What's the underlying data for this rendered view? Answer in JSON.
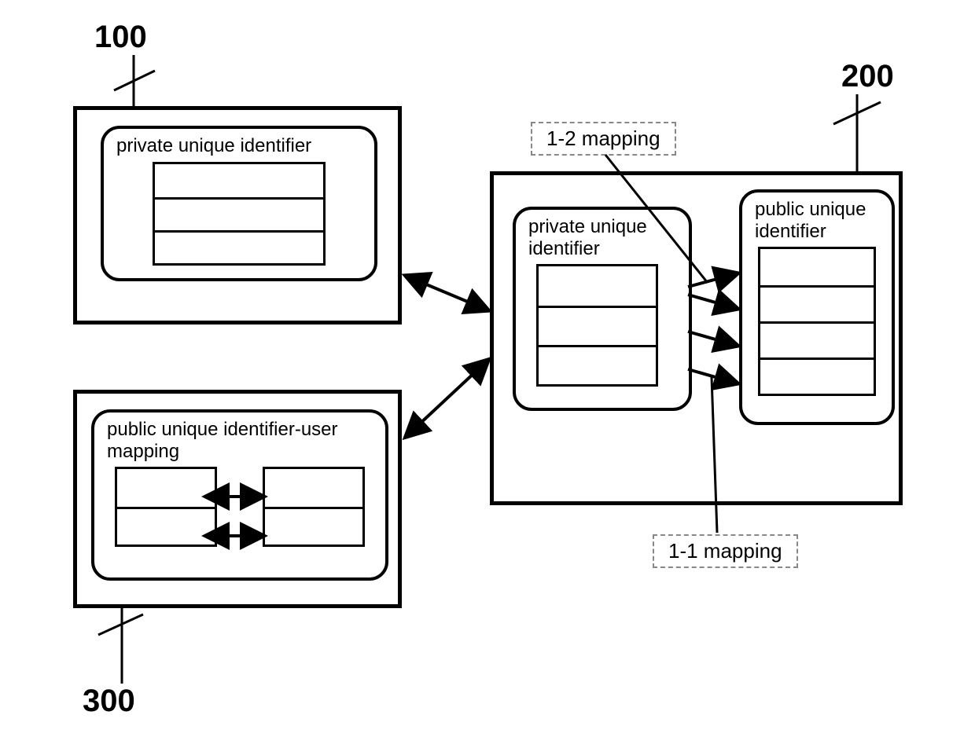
{
  "refs": {
    "r100": "100",
    "r200": "200",
    "r300": "300"
  },
  "box100": {
    "panel_title": "private unique identifier"
  },
  "box200": {
    "left_panel_title": "private unique\nidentifier",
    "right_panel_title": "public unique\nidentifier"
  },
  "box300": {
    "panel_title": "public unique identifier-user\nmapping"
  },
  "mapping_labels": {
    "m12": "1-2 mapping",
    "m11": "1-1 mapping"
  }
}
